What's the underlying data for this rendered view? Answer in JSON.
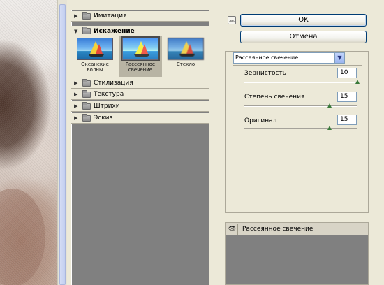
{
  "gallery": {
    "categories": [
      {
        "label": "Имитация",
        "expanded": false
      },
      {
        "label": "Искажение",
        "expanded": true
      },
      {
        "label": "Стилизация",
        "expanded": false
      },
      {
        "label": "Текстура",
        "expanded": false
      },
      {
        "label": "Штрихи",
        "expanded": false
      },
      {
        "label": "Эскиз",
        "expanded": false
      }
    ],
    "thumbnails": [
      {
        "label": "Океанские волны",
        "selected": false
      },
      {
        "label": "Рассеянное свечение",
        "selected": true
      },
      {
        "label": "Стекло",
        "selected": false
      }
    ],
    "collapsed_icon": "triangle-right-icon",
    "expanded_icon": "triangle-down-icon",
    "folder_icon": "folder-icon"
  },
  "buttons": {
    "ok": "OK",
    "cancel": "Отмена",
    "collapse_icon": "double-chevron-up-icon"
  },
  "settings": {
    "filter": "Рассеянное свечение",
    "dropdown_icon": "chevron-down-icon",
    "params": [
      {
        "label": "Зернистость",
        "value": "10",
        "slider": 1.0
      },
      {
        "label": "Степень свечения",
        "value": "15",
        "slider": 0.75
      },
      {
        "label": "Оригинал",
        "value": "15",
        "slider": 0.75
      }
    ]
  },
  "layers": {
    "items": [
      {
        "label": "Рассеянное свечение",
        "visible": true,
        "icon": "eye-icon"
      }
    ]
  },
  "colors": {
    "panel": "#ece9d8",
    "gallery_bg": "#808080",
    "button_border": "#003c74",
    "slider_thumb": "#3a7a3a"
  }
}
